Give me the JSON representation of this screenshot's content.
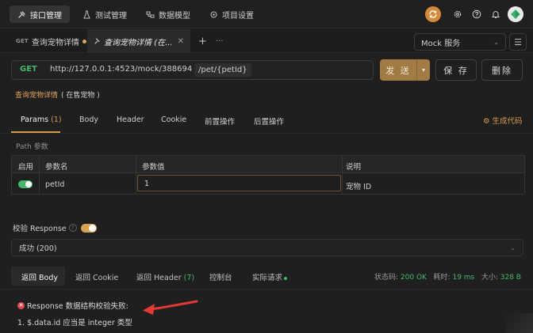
{
  "topbar": {
    "nav": [
      {
        "label": "接口管理",
        "icon": "api-icon",
        "active": true
      },
      {
        "label": "测试管理",
        "icon": "flask-icon",
        "active": false
      },
      {
        "label": "数据模型",
        "icon": "model-icon",
        "active": false
      },
      {
        "label": "项目设置",
        "icon": "settings-icon",
        "active": false
      }
    ]
  },
  "tabs": {
    "items": [
      {
        "method": "GET",
        "label": "查询宠物详情",
        "modified": true,
        "active": false
      },
      {
        "label": "查询宠物详情 (在...",
        "active": true
      }
    ],
    "new_tab": "+",
    "more": "···",
    "env": "Mock 服务"
  },
  "request": {
    "method": "GET",
    "base_url": "http://127.0.0.1:4523/mock/388694",
    "path": "/pet/{petId}",
    "send_label": "发 送",
    "save_label": "保 存",
    "delete_label": "删除"
  },
  "api": {
    "name": "查询宠物详情",
    "status": "( 在售宠物 )"
  },
  "request_tabs": {
    "params": "Params",
    "params_count": "(1)",
    "body": "Body",
    "header": "Header",
    "cookie": "Cookie",
    "pre": "前置操作",
    "post": "后置操作",
    "gen_code": "⚙ 生成代码"
  },
  "path_params": {
    "label": "Path 参数",
    "headers": [
      "启用",
      "参数名",
      "参数值",
      "说明"
    ],
    "rows": [
      {
        "enabled": true,
        "name": "petId",
        "value": "1",
        "desc": "宠物 ID"
      }
    ]
  },
  "validation": {
    "label": "校验 Response",
    "enabled": true,
    "response": "成功 (200)"
  },
  "response_tabs": {
    "body": "返回 Body",
    "cookie": "返回 Cookie",
    "header": "返回 Header",
    "header_count": "(7)",
    "console": "控制台",
    "actual": "实际请求"
  },
  "response_stats": {
    "status_label": "状态码:",
    "status_value": "200 OK",
    "time_label": "耗时:",
    "time_value": "19 ms",
    "size_label": "大小:",
    "size_value": "328 B"
  },
  "errors": {
    "title": "Response 数据结构校验失败:",
    "items": [
      "1. $.data.id 应当是 integer 类型"
    ]
  },
  "colors": {
    "accent": "#d69a4f",
    "get": "#46b86b",
    "error": "#e0494b",
    "arrow": "#e53935"
  }
}
